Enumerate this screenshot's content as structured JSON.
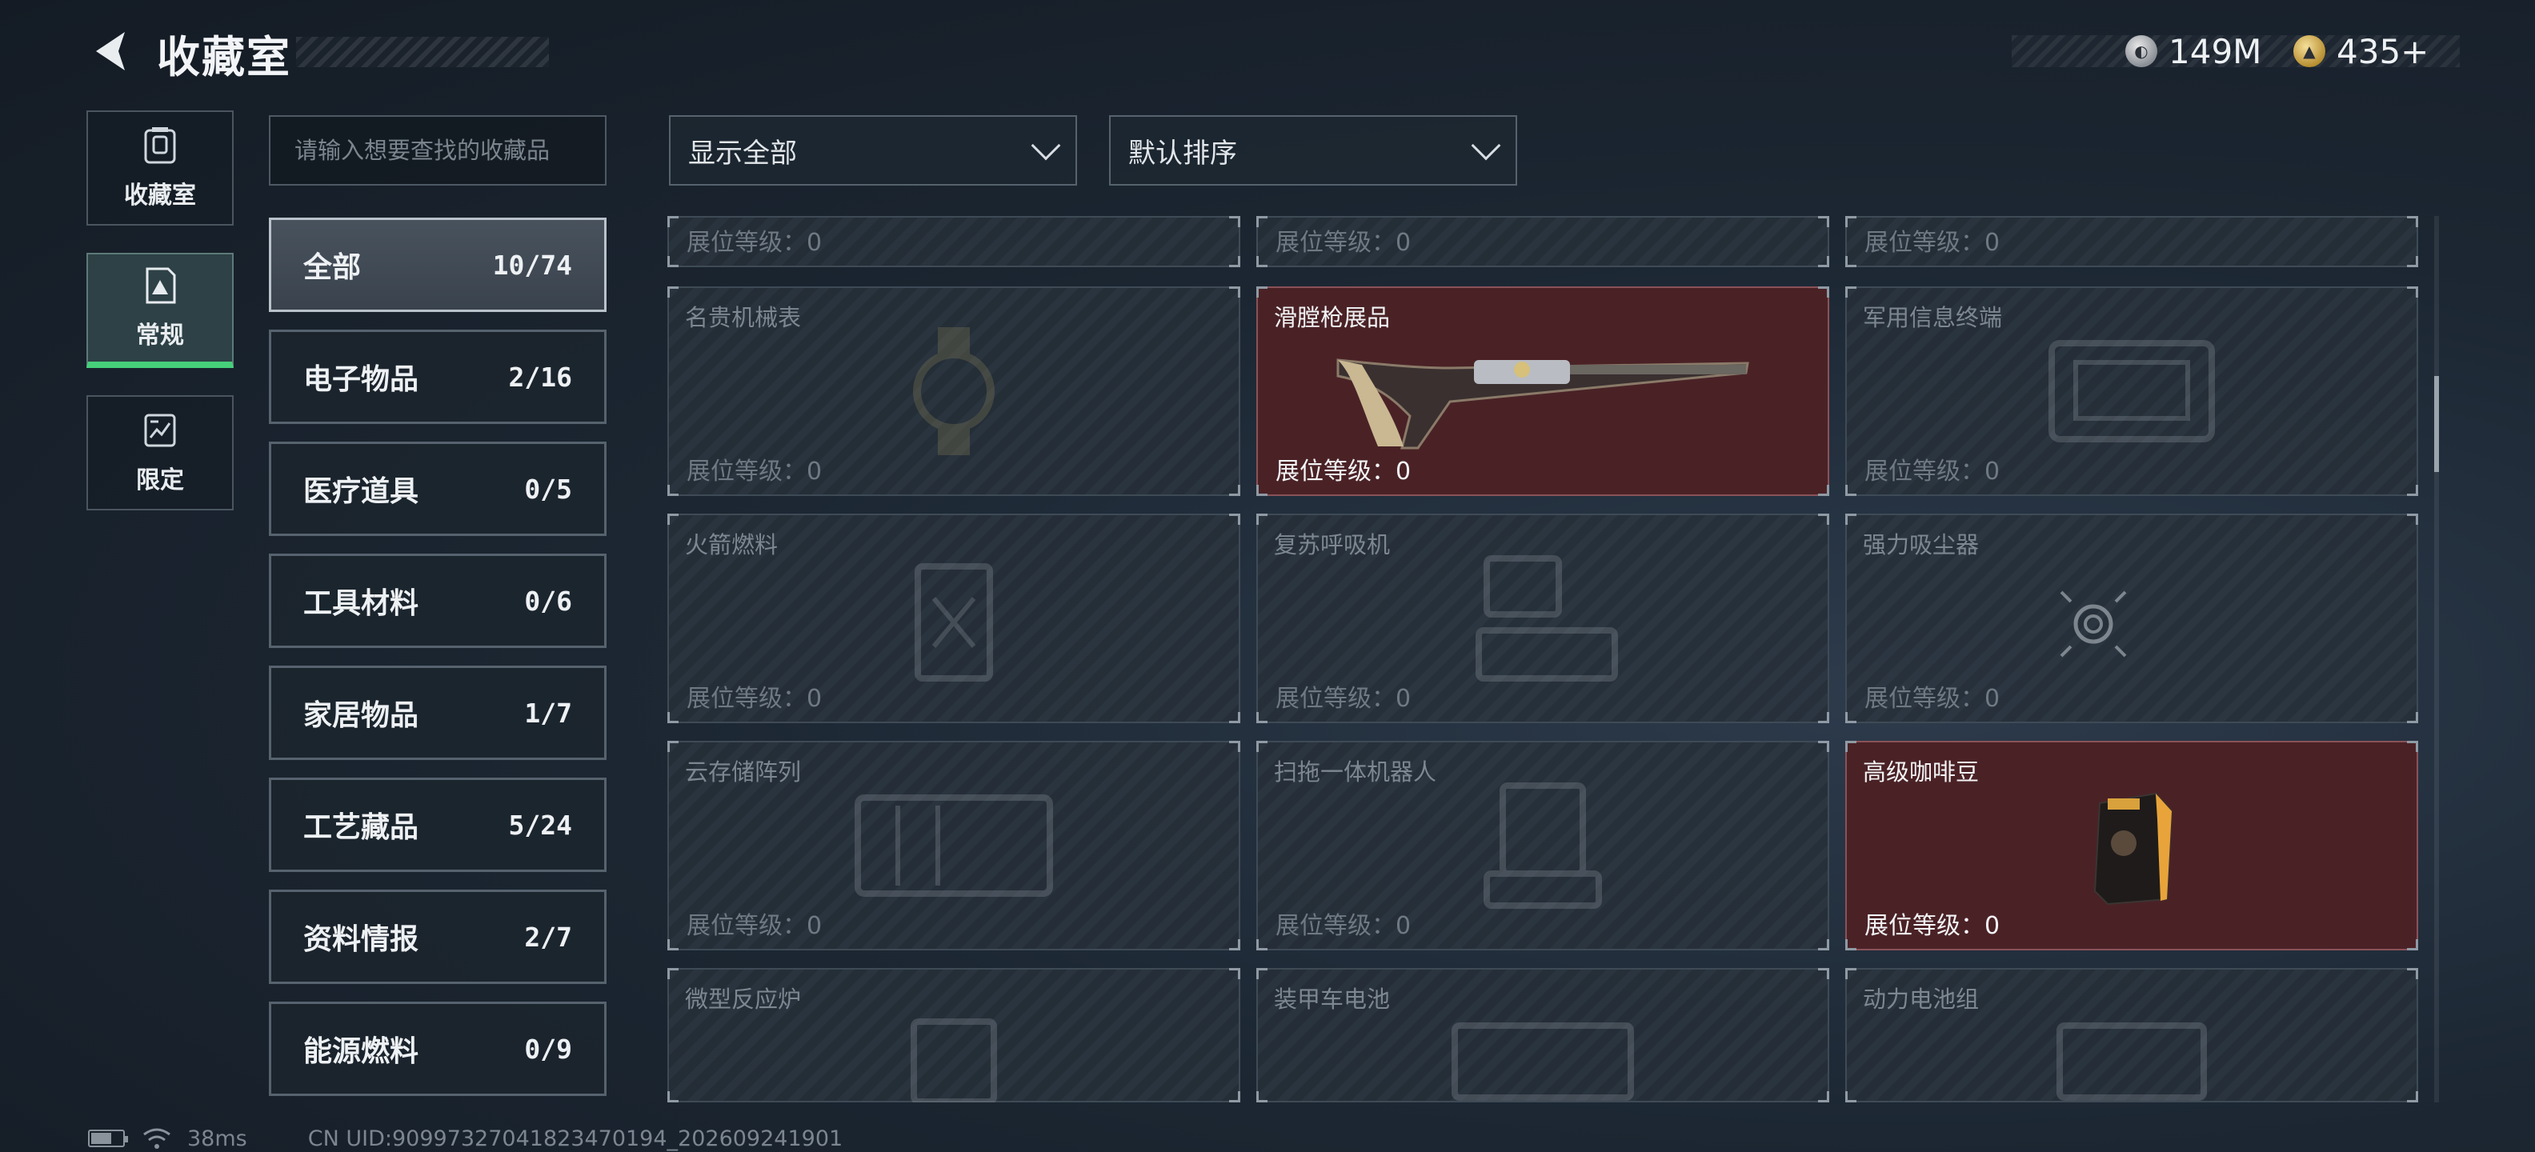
{
  "header": {
    "title": "收藏室",
    "currency": [
      {
        "icon": "silver-coin-icon",
        "value": "149M"
      },
      {
        "icon": "gold-coin-icon",
        "value": "435+"
      }
    ]
  },
  "left_tabs": [
    {
      "label": "收藏室",
      "icon": "collection-room-icon",
      "active": false
    },
    {
      "label": "常规",
      "icon": "regular-icon",
      "active": true
    },
    {
      "label": "限定",
      "icon": "limited-icon",
      "active": false
    }
  ],
  "search": {
    "placeholder": "请输入想要查找的收藏品"
  },
  "filters": {
    "display": "显示全部",
    "sort": "默认排序"
  },
  "categories": [
    {
      "name": "全部",
      "count": "10/74",
      "active": true
    },
    {
      "name": "电子物品",
      "count": "2/16"
    },
    {
      "name": "医疗道具",
      "count": "0/5"
    },
    {
      "name": "工具材料",
      "count": "0/6"
    },
    {
      "name": "家居物品",
      "count": "1/7"
    },
    {
      "name": "工艺藏品",
      "count": "5/24"
    },
    {
      "name": "资料情报",
      "count": "2/7"
    },
    {
      "name": "能源燃料",
      "count": "0/9"
    }
  ],
  "level_label": "展位等级：",
  "items": [
    {
      "name": "",
      "level": "0",
      "owned": false
    },
    {
      "name": "",
      "level": "0",
      "owned": false
    },
    {
      "name": "",
      "level": "0",
      "owned": false
    },
    {
      "name": "名贵机械表",
      "level": "0",
      "owned": false
    },
    {
      "name": "滑膛枪展品",
      "level": "0",
      "owned": true
    },
    {
      "name": "军用信息终端",
      "level": "0",
      "owned": false
    },
    {
      "name": "火箭燃料",
      "level": "0",
      "owned": false
    },
    {
      "name": "复苏呼吸机",
      "level": "0",
      "owned": false
    },
    {
      "name": "强力吸尘器",
      "level": "0",
      "owned": false
    },
    {
      "name": "云存储阵列",
      "level": "0",
      "owned": false
    },
    {
      "name": "扫拖一体机器人",
      "level": "0",
      "owned": false
    },
    {
      "name": "高级咖啡豆",
      "level": "0",
      "owned": true
    },
    {
      "name": "微型反应炉",
      "level": "",
      "owned": false
    },
    {
      "name": "装甲车电池",
      "level": "",
      "owned": false
    },
    {
      "name": "动力电池组",
      "level": "",
      "owned": false
    }
  ],
  "status_bar": {
    "ping": "38ms",
    "uid": "CN UID:9099732704182347019​4_202609241901"
  },
  "colors": {
    "accent_green": "#46d07a",
    "owned_bg": "#4a2226"
  }
}
